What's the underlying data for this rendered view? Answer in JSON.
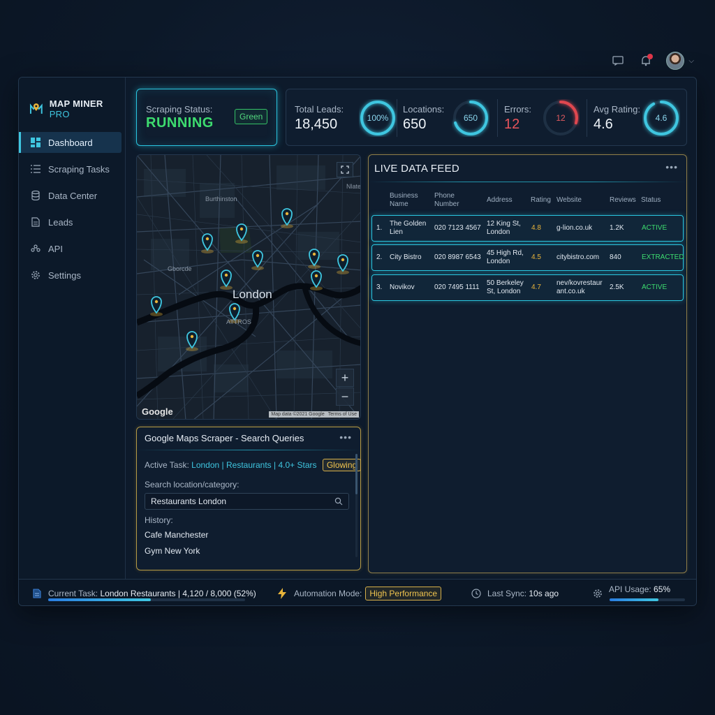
{
  "header": {
    "icons": [
      "chat-icon",
      "bell-icon",
      "avatar",
      "chevron-down-icon"
    ]
  },
  "app": {
    "brand": "MAP MINER",
    "brand_suffix": "PRO"
  },
  "sidebar": {
    "items": [
      {
        "label": "Dashboard",
        "icon": "dashboard-icon",
        "active": true
      },
      {
        "label": "Scraping Tasks",
        "icon": "list-icon"
      },
      {
        "label": "Data Center",
        "icon": "database-icon"
      },
      {
        "label": "Leads",
        "icon": "document-icon"
      },
      {
        "label": "API",
        "icon": "api-icon"
      },
      {
        "label": "Settings",
        "icon": "gear-icon"
      }
    ]
  },
  "status": {
    "label": "Scraping Status:",
    "value": "RUNNING",
    "badge": "Green"
  },
  "metrics": [
    {
      "label": "Total Leads:",
      "value": "18,450",
      "ring_text": "100%",
      "ring_pct": 1.0,
      "color": "#3fc6e0"
    },
    {
      "label": "Locations:",
      "value": "650",
      "ring_text": "650",
      "ring_pct": 0.7,
      "color": "#3fc6e0"
    },
    {
      "label": "Errors:",
      "value": "12",
      "ring_text": "12",
      "ring_pct": 0.3,
      "color": "#e0474f"
    },
    {
      "label": "Avg Rating:",
      "value": "4.6",
      "ring_text": "4.6",
      "ring_pct": 0.92,
      "color": "#3fc6e0"
    }
  ],
  "map": {
    "city": "London",
    "labels": [
      "Burthinston",
      "Gborcde",
      "Nlate",
      "ATTROS"
    ],
    "brand": "Google",
    "attribution": "Map data ©2021 Google",
    "terms": "Terms of Use",
    "zoom_in": "+",
    "zoom_out": "−"
  },
  "query": {
    "title": "Google Maps Scraper - Search Queries",
    "active_label": "Active Task:",
    "active_value": "London | Restaurants | 4.0+ Stars",
    "active_badge": "Glowing",
    "search_label": "Search location/category:",
    "search_value": "Restaurants London",
    "history_label": "History:",
    "history": [
      "Cafe Manchester",
      "Gym New York"
    ]
  },
  "feed": {
    "title": "LIVE DATA FEED",
    "columns": [
      "Business Name",
      "Phone Number",
      "Address",
      "Rating",
      "Website",
      "Reviews",
      "Status"
    ],
    "rows": [
      {
        "n": "1.",
        "name": "The Golden Lien",
        "phone": "020 7123 4567",
        "address": "12 King St, London",
        "rating": "4.8",
        "website": "g-lion.co.uk",
        "reviews": "1.2K",
        "status": "ACTIVE"
      },
      {
        "n": "2.",
        "name": "City Bistro",
        "phone": "020 8987 6543",
        "address": "45 High Rd, London",
        "rating": "4.5",
        "website": "citybistro.com",
        "reviews": "840",
        "status": "EXTRACTED"
      },
      {
        "n": "3.",
        "name": "Novikov",
        "phone": "020 7495 1111",
        "address": "50 Berkeley St, London",
        "rating": "4.7",
        "website": "nev/kovrestaurant.co.uk",
        "reviews": "2.5K",
        "status": "ACTIVE"
      }
    ]
  },
  "footer": {
    "task_label": "Current Task:",
    "task_value": "London Restaurants | 4,120 / 8,000 (52%)",
    "task_pct": 0.52,
    "mode_label": "Automation Mode:",
    "mode_value": "High Performance",
    "sync_label": "Last Sync:",
    "sync_value": "10s ago",
    "api_label": "API Usage:",
    "api_value": "65%",
    "api_pct": 0.65
  }
}
